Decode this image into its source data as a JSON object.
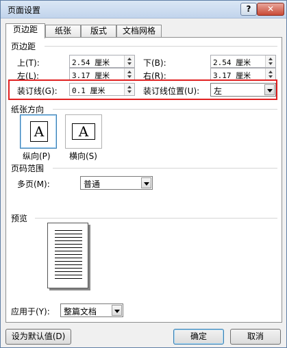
{
  "window": {
    "title": "页面设置",
    "help": "?",
    "close": "✕"
  },
  "tabs": [
    "页边距",
    "纸张",
    "版式",
    "文档网格"
  ],
  "margins": {
    "section": "页边距",
    "top_label": "上(T):",
    "top_value": "2.54 厘米",
    "bottom_label": "下(B):",
    "bottom_value": "2.54 厘米",
    "left_label": "左(L):",
    "left_value": "3.17 厘米",
    "right_label": "右(R):",
    "right_value": "3.17 厘米",
    "gutter_label": "装订线(G):",
    "gutter_value": "0.1 厘米",
    "gutter_pos_label": "装订线位置(U):",
    "gutter_pos_value": "左"
  },
  "orientation": {
    "section": "纸张方向",
    "portrait": "纵向(P)",
    "landscape": "横向(S)",
    "glyph": "A"
  },
  "pages": {
    "section": "页码范围",
    "multiple_label": "多页(M):",
    "multiple_value": "普通"
  },
  "preview": {
    "section": "预览"
  },
  "apply": {
    "label": "应用于(Y):",
    "value": "整篇文档"
  },
  "buttons": {
    "default": "设为默认值(D)",
    "ok": "确定",
    "cancel": "取消"
  }
}
